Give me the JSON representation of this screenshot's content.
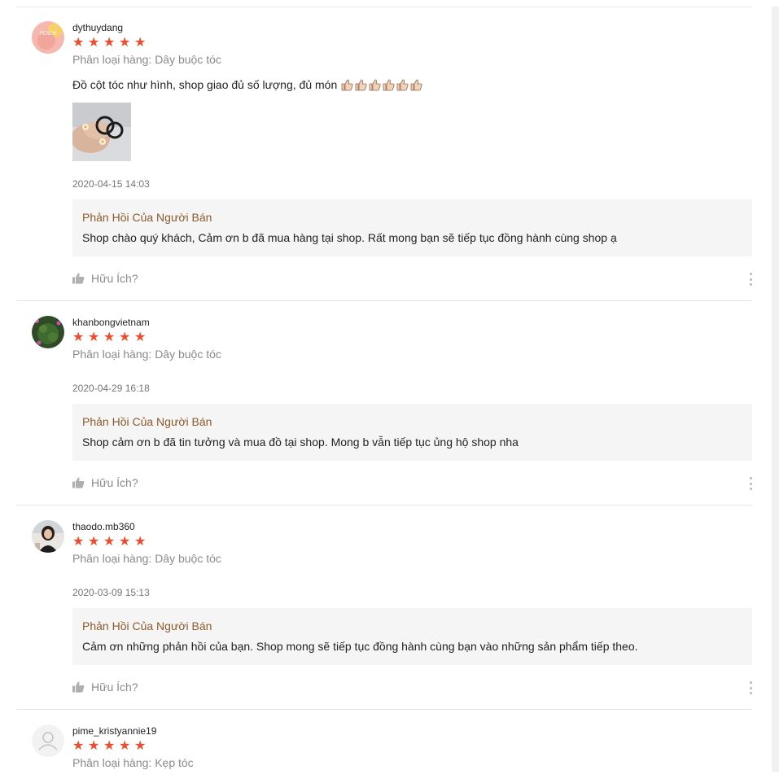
{
  "reviews": [
    {
      "username": "dythuydang",
      "rating": 5,
      "variation": "Phân loại hàng: Dây buộc tóc",
      "comment": "Đồ cột tóc như hình, shop giao đủ số lượng, đủ món",
      "thumbs_count": 6,
      "has_photo": true,
      "datetime": "2020-04-15 14:03",
      "reply_title": "Phản Hồi Của Người Bán",
      "reply_text": "Shop chào quý khách, Cảm ơn b đã mua hàng tại shop. Rất mong bạn sẽ tiếp tục đồng hành cùng shop ạ",
      "helpful_label": "Hữu Ích?",
      "avatar_text": "PEACH"
    },
    {
      "username": "khanbongvietnam",
      "rating": 5,
      "variation": "Phân loại hàng: Dây buộc tóc",
      "datetime": "2020-04-29 16:18",
      "reply_title": "Phản Hồi Của Người Bán",
      "reply_text": "Shop cảm ơn b đã tin tưởng và mua đồ tại shop. Mong b vẫn tiếp tục ủng hộ shop nha",
      "helpful_label": "Hữu Ích?"
    },
    {
      "username": "thaodo.mb360",
      "rating": 5,
      "variation": "Phân loại hàng: Dây buộc tóc",
      "datetime": "2020-03-09 15:13",
      "reply_title": "Phản Hồi Của Người Bán",
      "reply_text": "Cảm ơn những phản hồi của bạn. Shop mong sẽ tiếp tục đồng hành cùng bạn vào những sản phẩm tiếp theo.",
      "helpful_label": "Hữu Ích?"
    },
    {
      "username": "pime_kristyannie19",
      "rating": 5,
      "variation": "Phân loại hàng: Kẹp tóc"
    }
  ],
  "colors": {
    "star": "#ee4d2d",
    "reply_title": "#8b5a2b",
    "muted": "#8a8a8a"
  },
  "icons": {
    "star": "star-icon",
    "thumbs_up": "thumbs-up-icon",
    "more": "more-vertical-icon"
  }
}
